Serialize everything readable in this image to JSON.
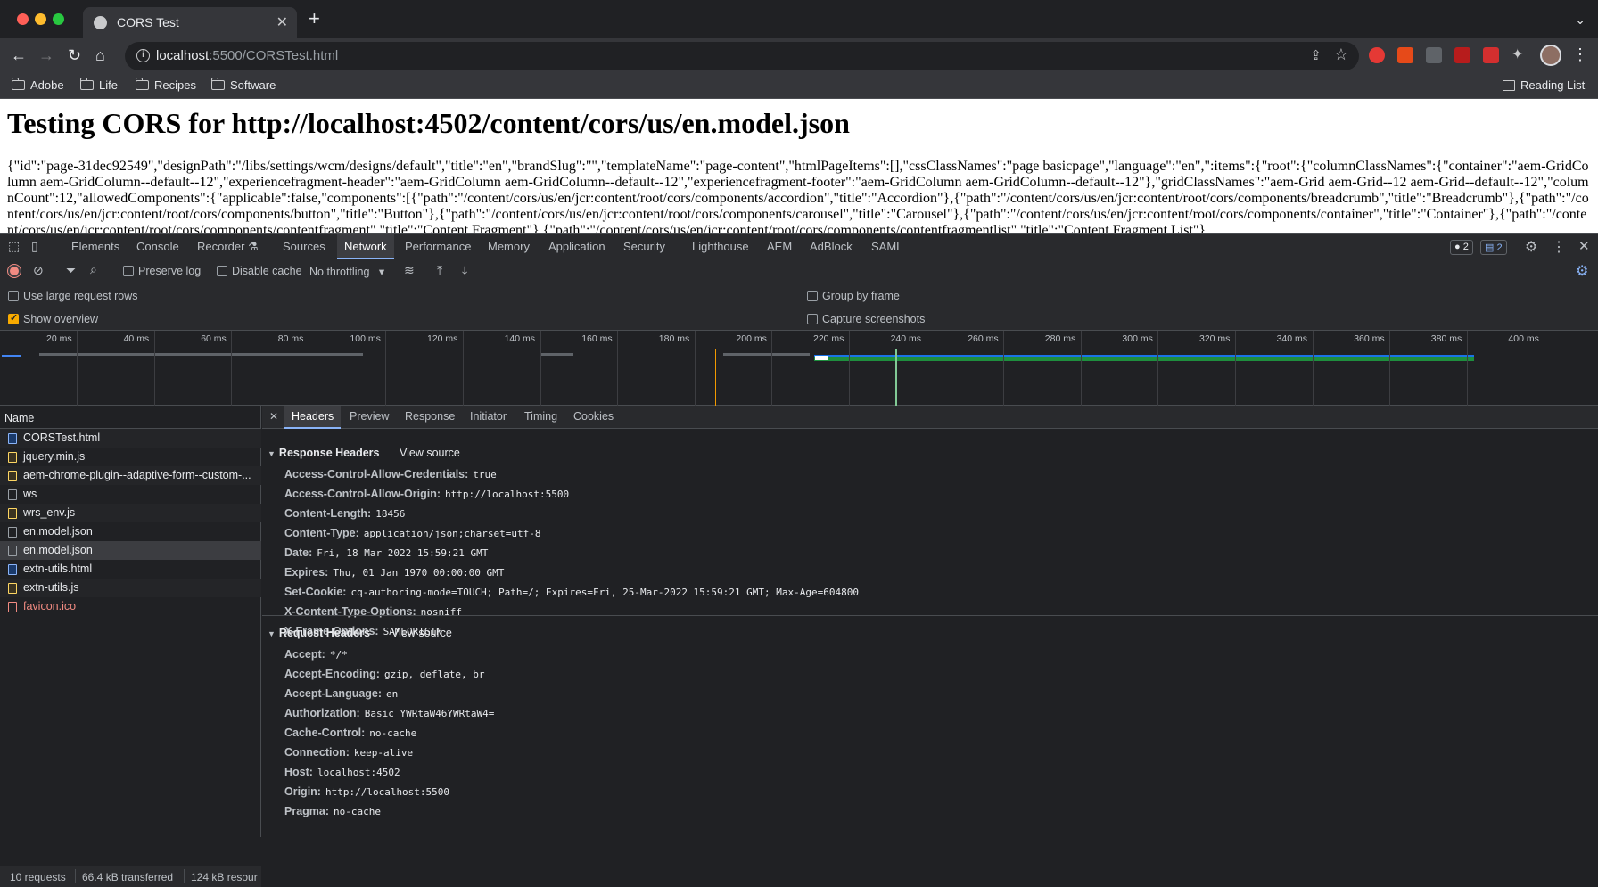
{
  "browser": {
    "tab_title": "CORS Test",
    "url_host": "localhost",
    "url_rest": ":5500/CORSTest.html",
    "bookmarks": [
      "Adobe",
      "Life",
      "Recipes",
      "Software"
    ],
    "reading_list": "Reading List"
  },
  "page": {
    "heading": "Testing CORS for http://localhost:4502/content/cors/us/en.model.json",
    "json_text": "{\"id\":\"page-31dec92549\",\"designPath\":\"/libs/settings/wcm/designs/default\",\"title\":\"en\",\"brandSlug\":\"\",\"templateName\":\"page-content\",\"htmlPageItems\":[],\"cssClassNames\":\"page basicpage\",\"language\":\"en\",\":items\":{\"root\":{\"columnClassNames\":{\"container\":\"aem-GridColumn aem-GridColumn--default--12\",\"experiencefragment-header\":\"aem-GridColumn aem-GridColumn--default--12\",\"experiencefragment-footer\":\"aem-GridColumn aem-GridColumn--default--12\"},\"gridClassNames\":\"aem-Grid aem-Grid--12 aem-Grid--default--12\",\"columnCount\":12,\"allowedComponents\":{\"applicable\":false,\"components\":[{\"path\":\"/content/cors/us/en/jcr:content/root/cors/components/accordion\",\"title\":\"Accordion\"},{\"path\":\"/content/cors/us/en/jcr:content/root/cors/components/breadcrumb\",\"title\":\"Breadcrumb\"},{\"path\":\"/content/cors/us/en/jcr:content/root/cors/components/button\",\"title\":\"Button\"},{\"path\":\"/content/cors/us/en/jcr:content/root/cors/components/carousel\",\"title\":\"Carousel\"},{\"path\":\"/content/cors/us/en/jcr:content/root/cors/components/container\",\"title\":\"Container\"},{\"path\":\"/content/cors/us/en/jcr:content/root/cors/components/contentfragment\",\"title\":\"Content Fragment\"},{\"path\":\"/content/cors/us/en/jcr:content/root/cors/components/contentfragmentlist\",\"title\":\"Content Fragment List\"},"
  },
  "devtools": {
    "tabs": [
      "Elements",
      "Console",
      "Recorder ⚗",
      "Sources",
      "Network",
      "Performance",
      "Memory",
      "Application",
      "Security",
      "Lighthouse",
      "AEM",
      "AdBlock",
      "SAML"
    ],
    "issues_badge": "2",
    "messages_badge": "2",
    "preserve_log": "Preserve log",
    "disable_cache": "Disable cache",
    "throttling": "No throttling",
    "use_large_rows": "Use large request rows",
    "show_overview": "Show overview",
    "group_by_frame": "Group by frame",
    "capture_screenshots": "Capture screenshots",
    "timeline_labels": [
      "20 ms",
      "40 ms",
      "60 ms",
      "80 ms",
      "100 ms",
      "120 ms",
      "140 ms",
      "160 ms",
      "180 ms",
      "200 ms",
      "220 ms",
      "240 ms",
      "260 ms",
      "280 ms",
      "300 ms",
      "320 ms",
      "340 ms",
      "360 ms",
      "380 ms",
      "400 ms"
    ],
    "name_header": "Name",
    "requests": [
      {
        "name": "CORSTest.html",
        "type": "html"
      },
      {
        "name": "jquery.min.js",
        "type": "js"
      },
      {
        "name": "aem-chrome-plugin--adaptive-form--custom-...",
        "type": "js"
      },
      {
        "name": "ws",
        "type": "other"
      },
      {
        "name": "wrs_env.js",
        "type": "js"
      },
      {
        "name": "en.model.json",
        "type": "other"
      },
      {
        "name": "en.model.json",
        "type": "other",
        "selected": true
      },
      {
        "name": "extn-utils.html",
        "type": "html"
      },
      {
        "name": "extn-utils.js",
        "type": "js"
      },
      {
        "name": "favicon.ico",
        "type": "err"
      }
    ],
    "status": {
      "requests": "10 requests",
      "transferred": "66.4 kB transferred",
      "resources": "124 kB resour"
    },
    "detail_tabs": [
      "Headers",
      "Preview",
      "Response",
      "Initiator",
      "Timing",
      "Cookies"
    ],
    "response_headers_title": "Response Headers",
    "request_headers_title": "Request Headers",
    "view_source": "View source",
    "response_headers": [
      {
        "name": "Access-Control-Allow-Credentials:",
        "value": "true"
      },
      {
        "name": "Access-Control-Allow-Origin:",
        "value": "http://localhost:5500"
      },
      {
        "name": "Content-Length:",
        "value": "18456"
      },
      {
        "name": "Content-Type:",
        "value": "application/json;charset=utf-8"
      },
      {
        "name": "Date:",
        "value": "Fri, 18 Mar 2022 15:59:21 GMT"
      },
      {
        "name": "Expires:",
        "value": "Thu, 01 Jan 1970 00:00:00 GMT"
      },
      {
        "name": "Set-Cookie:",
        "value": "cq-authoring-mode=TOUCH; Path=/; Expires=Fri, 25-Mar-2022 15:59:21 GMT; Max-Age=604800"
      },
      {
        "name": "X-Content-Type-Options:",
        "value": "nosniff"
      },
      {
        "name": "X-Frame-Options:",
        "value": "SAMEORIGIN"
      }
    ],
    "request_headers": [
      {
        "name": "Accept:",
        "value": "*/*"
      },
      {
        "name": "Accept-Encoding:",
        "value": "gzip, deflate, br"
      },
      {
        "name": "Accept-Language:",
        "value": "en"
      },
      {
        "name": "Authorization:",
        "value": "Basic YWRtaW46YWRtaW4="
      },
      {
        "name": "Cache-Control:",
        "value": "no-cache"
      },
      {
        "name": "Connection:",
        "value": "keep-alive"
      },
      {
        "name": "Host:",
        "value": "localhost:4502"
      },
      {
        "name": "Origin:",
        "value": "http://localhost:5500"
      },
      {
        "name": "Pragma:",
        "value": "no-cache"
      }
    ]
  }
}
